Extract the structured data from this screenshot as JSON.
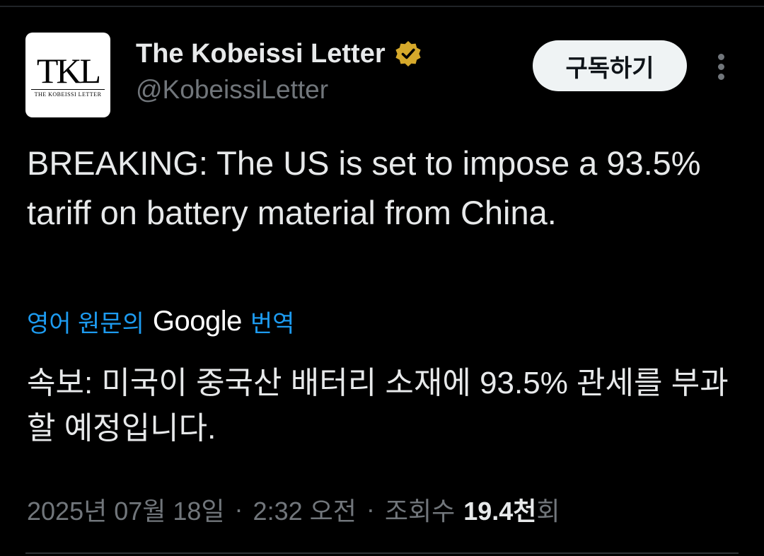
{
  "author": {
    "display_name": "The Kobeissi Letter",
    "handle": "@KobeissiLetter",
    "avatar_monogram": "TKL",
    "avatar_subtext": "THE KOBEISSI LETTER",
    "verified_badge_icon": "verified-badge-icon",
    "badge_color": "#d6a92b"
  },
  "actions": {
    "subscribe_label": "구독하기",
    "more_icon": "more-vertical-icon"
  },
  "tweet": {
    "text": "BREAKING: The US is set to impose a 93.5% tariff on battery material from China."
  },
  "translation": {
    "prefix": "영어 원문의",
    "provider": "Google",
    "suffix": "번역",
    "text": "속보: 미국이 중국산 배터리 소재에 93.5% 관세를 부과할 예정입니다."
  },
  "meta": {
    "date": "2025년 07월 18일",
    "separator": "·",
    "time": "2:32 오전",
    "views_label": "조회수",
    "views_count": "19.4천",
    "views_suffix": "회"
  },
  "colors": {
    "background": "#000000",
    "text_primary": "#e7e9ea",
    "text_secondary": "#71767b",
    "link": "#1d9bf0"
  }
}
